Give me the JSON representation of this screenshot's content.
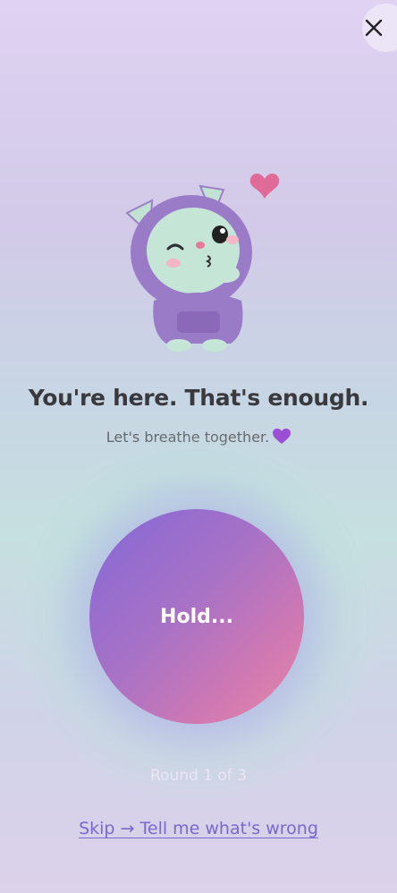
{
  "close_button": {
    "icon": "close-icon"
  },
  "mascot": {
    "icon": "kitten-hoodie-mascot",
    "accent_heart": "heart-icon"
  },
  "headline": "You're here. That's enough.",
  "subline": "Let's breathe together.",
  "subline_icon": "purple-heart-icon",
  "breath": {
    "label": "Hold..."
  },
  "round": "Round 1 of 3",
  "skip": "Skip → Tell me what's wrong",
  "colors": {
    "accent": "#7a68d2",
    "circle_start": "#8468d6",
    "circle_end": "#e88aa8",
    "text_dark": "#3a3a3e"
  }
}
